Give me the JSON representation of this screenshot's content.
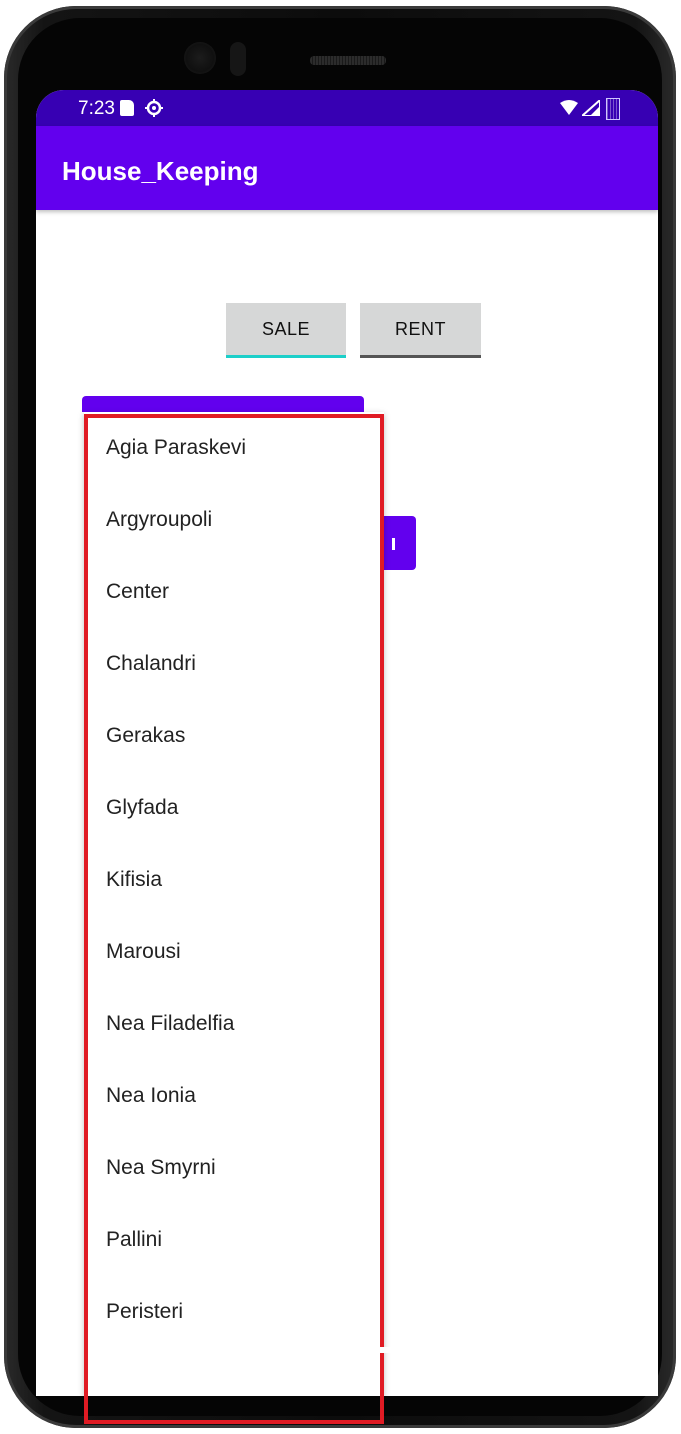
{
  "status_bar": {
    "time": "7:23",
    "icons": [
      "sd-card-icon",
      "gear-icon",
      "wifi-icon",
      "signal-icon",
      "battery-icon"
    ]
  },
  "app_bar": {
    "title": "House_Keeping"
  },
  "tabs": {
    "sale_label": "SALE",
    "rent_label": "RENT",
    "active": "SALE"
  },
  "dropdown": {
    "items": [
      "Agia Paraskevi",
      "Argyroupoli",
      "Center",
      "Chalandri",
      "Gerakas",
      "Glyfada",
      "Kifisia",
      "Marousi",
      "Nea Filadelfia",
      "Nea Ionia",
      "Nea Smyrni",
      "Pallini",
      "Peristeri"
    ]
  },
  "colors": {
    "status_bar": "#3700b3",
    "app_bar": "#6200ee",
    "accent_underline": "#1ccfc9",
    "highlight_border": "#e01b24"
  }
}
